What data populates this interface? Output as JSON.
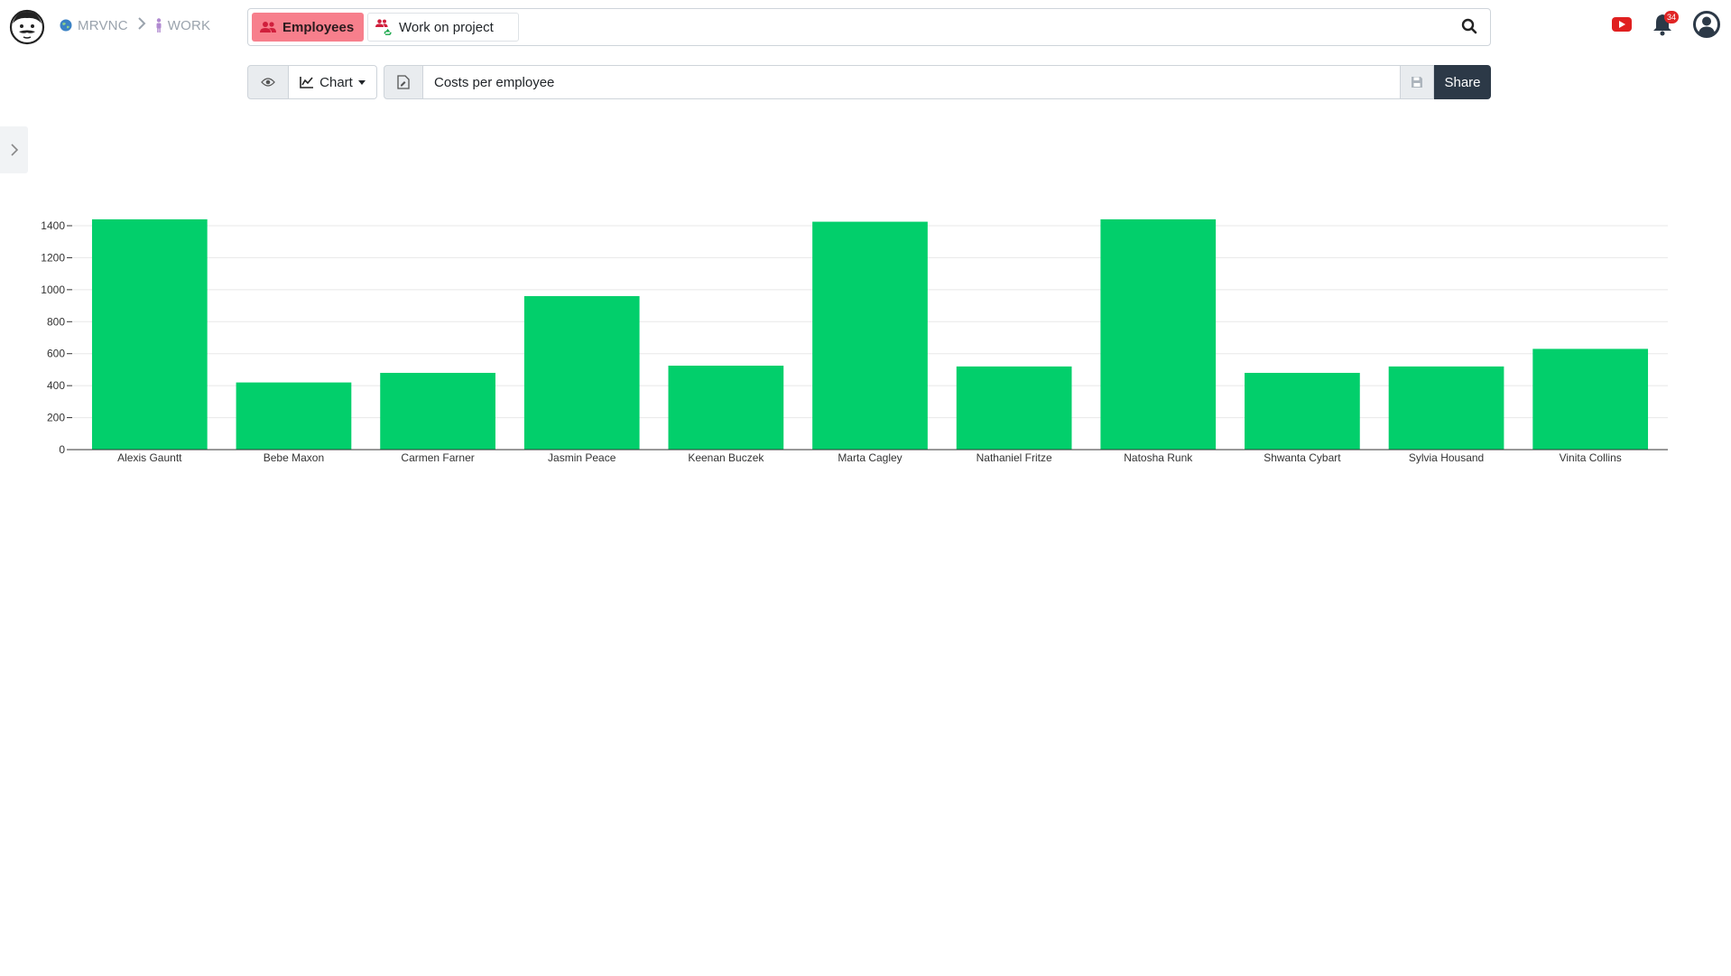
{
  "colors": {
    "active_chip": "#f77f8c",
    "bar": "#02cf6b",
    "share_button": "#2c3947",
    "badge": "#e02424",
    "youtube": "#e02020"
  },
  "breadcrumb": {
    "items": [
      {
        "label": "MRVNC",
        "icon": "globe-icon"
      },
      {
        "label": "WORK",
        "icon": "person-icon"
      }
    ]
  },
  "search": {
    "chips": [
      {
        "label": "Employees",
        "icon": "users-icon",
        "active": true
      },
      {
        "label": "Work on project",
        "icon": "users-recycle-icon",
        "active": false
      }
    ],
    "value": ""
  },
  "notifications": {
    "count": "34"
  },
  "toolbar": {
    "view_label": "Chart",
    "title_value": "Costs per employee",
    "share_label": "Share"
  },
  "chart_data": {
    "type": "bar",
    "title": "",
    "xlabel": "",
    "ylabel": "",
    "ylim": [
      0,
      1400
    ],
    "yticks": [
      0,
      200,
      400,
      600,
      800,
      1000,
      1200,
      1400
    ],
    "grid": true,
    "categories": [
      "Alexis Gauntt",
      "Bebe Maxon",
      "Carmen Farner",
      "Jasmin Peace",
      "Keenan Buczek",
      "Marta Cagley",
      "Nathaniel Fritze",
      "Natosha Runk",
      "Shwanta Cybart",
      "Sylvia Housand",
      "Vinita Collins"
    ],
    "values": [
      1440,
      420,
      480,
      960,
      525,
      1425,
      520,
      1440,
      480,
      520,
      630
    ]
  }
}
